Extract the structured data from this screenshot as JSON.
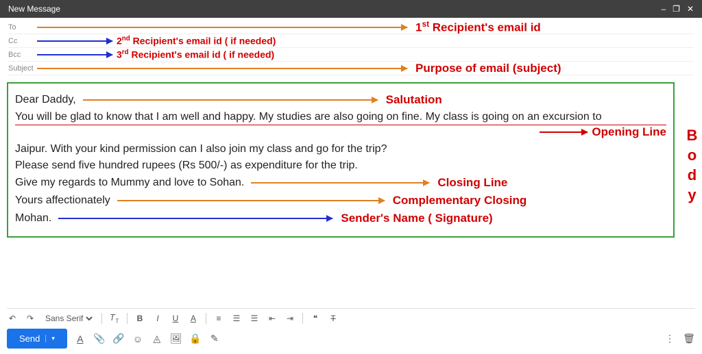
{
  "titlebar": {
    "title": "New Message"
  },
  "fields": {
    "to": "To",
    "cc": "Cc",
    "bcc": "Bcc",
    "subject": "Subject"
  },
  "annotations": {
    "to": "1<sup>st</sup> Recipient's email id",
    "cc": "2<sup>nd</sup> Recipient's email id ( if needed)",
    "bcc": "3<sup>rd</sup> Recipient's email id ( if needed)",
    "subject": "Purpose of email (subject)",
    "salutation": "Salutation",
    "opening": "Opening Line",
    "closing": "Closing Line",
    "complementary": "Complementary Closing",
    "signature": "Sender's Name ( Signature)",
    "body": "Body"
  },
  "email": {
    "salutation": "Dear Daddy,",
    "line1": "You will be glad to know that I am well and happy. My studies are also going on fine. My class is going on an excursion to",
    "line2": "Jaipur. With your kind permission can I also join my class and go for the trip?",
    "line3": "Please send five hundred rupees (Rs 500/-) as expenditure for the trip.",
    "line4": "Give my regards to Mummy and love to Sohan.",
    "complementary": "Yours affectionately",
    "signature": "Mohan."
  },
  "toolbar": {
    "font": "Sans Serif",
    "send": "Send"
  }
}
